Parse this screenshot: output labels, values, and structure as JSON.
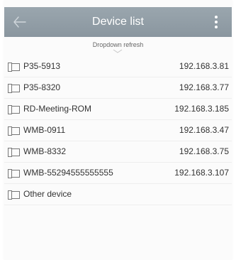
{
  "header": {
    "title": "Device list",
    "back_icon": "back-arrow-icon",
    "menu_icon": "more-vertical-icon"
  },
  "refresh_hint": "Dropdown refresh",
  "devices": [
    {
      "name": "P35-5913",
      "ip": "192.168.3.81"
    },
    {
      "name": "P35-8320",
      "ip": "192.168.3.77"
    },
    {
      "name": "RD-Meeting-ROM",
      "ip": "192.168.3.185"
    },
    {
      "name": "WMB-0911",
      "ip": "192.168.3.47"
    },
    {
      "name": "WMB-8332",
      "ip": "192.168.3.75"
    },
    {
      "name": "WMB-55294555555555",
      "ip": "192.168.3.107"
    },
    {
      "name": "Other device",
      "ip": ""
    }
  ],
  "colors": {
    "header_bg": "#8f9ba4",
    "header_text": "#ffffff",
    "text": "#333333"
  }
}
